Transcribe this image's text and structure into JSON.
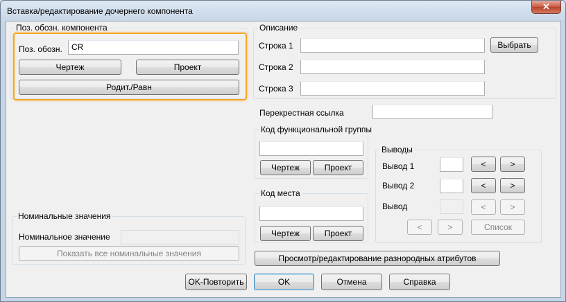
{
  "window": {
    "title": "Вставка/редактирование дочернего компонента",
    "close": "✕"
  },
  "tag_group": {
    "label": "Поз. обозн. компонента",
    "tag_label": "Поз. обозн.",
    "tag_value": "CR",
    "drawing_btn": "Чертеж",
    "project_btn": "Проект",
    "parent_btn": "Родит./Равн"
  },
  "description": {
    "label": "Описание",
    "line1": "Строка 1",
    "line2": "Строка 2",
    "line3": "Строка 3",
    "select_btn": "Выбрать",
    "line1_value": "",
    "line2_value": "",
    "line3_value": ""
  },
  "crossref": {
    "label": "Перекрестная ссылка",
    "value": ""
  },
  "function_code": {
    "label": "Код функциональной группы",
    "value": "",
    "drawing_btn": "Чертеж",
    "project_btn": "Проект"
  },
  "location_code": {
    "label": "Код места",
    "value": "",
    "drawing_btn": "Чертеж",
    "project_btn": "Проект"
  },
  "pins": {
    "label": "Выводы",
    "pin1": "Вывод 1",
    "pin2": "Вывод 2",
    "pin": "Вывод",
    "prev": "<",
    "next": ">",
    "list_btn": "Список"
  },
  "ratings": {
    "label": "Номинальные значения",
    "rating_label": "Номинальное значение",
    "show_all_btn": "Показать все номинальные значения"
  },
  "attr_btn": "Просмотр/редактирование разнородных атрибутов",
  "footer": {
    "ok_repeat": "OK-Повторить",
    "ok": "OK",
    "cancel": "Отмена",
    "help": "Справка"
  }
}
